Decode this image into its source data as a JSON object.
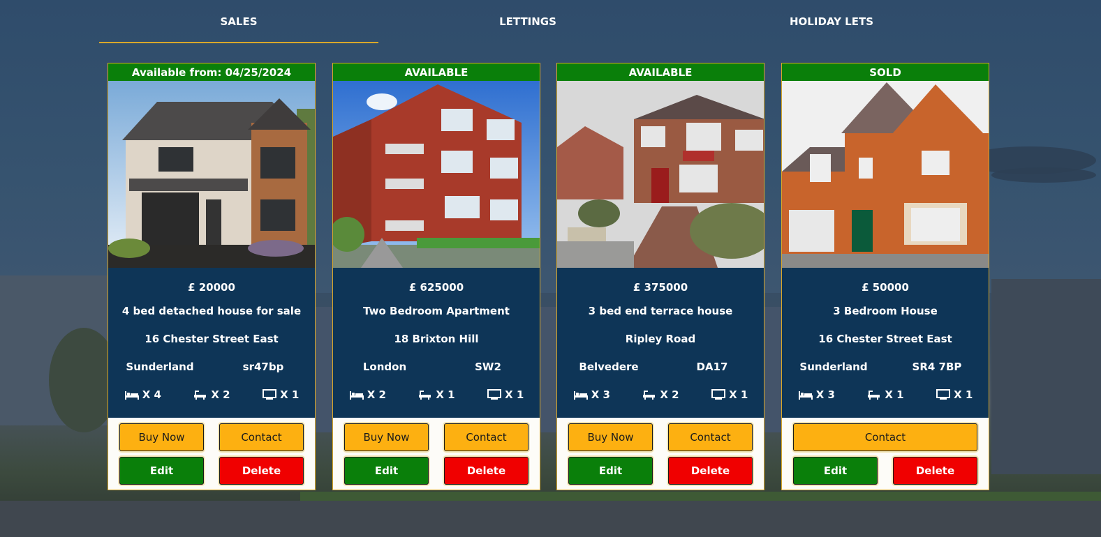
{
  "tabs": [
    {
      "label": "SALES",
      "active": true
    },
    {
      "label": "LETTINGS",
      "active": false
    },
    {
      "label": "HOLIDAY LETS",
      "active": false
    }
  ],
  "colors": {
    "accent": "#d9a82a",
    "status_green": "#0a7f0a",
    "info_panel": "#0e3557",
    "button_gold": "#fdb011",
    "button_green": "#0a7f0a",
    "button_red": "#f00000"
  },
  "listings": [
    {
      "status": "Available from: 04/25/2024",
      "photo": "detached-house-photo",
      "price": "£ 20000",
      "title": "4 bed detached house for sale",
      "street": "16 Chester Street East",
      "city": "Sunderland",
      "postcode": "sr47bp",
      "bedrooms": "X 4",
      "bathrooms": "X 2",
      "receptions": "X 1",
      "buy_label": "Buy Now",
      "contact_label": "Contact",
      "edit_label": "Edit",
      "delete_label": "Delete"
    },
    {
      "status": "AVAILABLE",
      "photo": "apartment-block-photo",
      "price": "£ 625000",
      "title": "Two Bedroom Apartment",
      "street": "18 Brixton Hill",
      "city": "London",
      "postcode": "SW2",
      "bedrooms": "X 2",
      "bathrooms": "X 1",
      "receptions": "X 1",
      "buy_label": "Buy Now",
      "contact_label": "Contact",
      "edit_label": "Edit",
      "delete_label": "Delete"
    },
    {
      "status": "AVAILABLE",
      "photo": "end-terrace-house-photo",
      "price": "£ 375000",
      "title": "3 bed end terrace house",
      "street": "Ripley Road",
      "city": "Belvedere",
      "postcode": "DA17",
      "bedrooms": "X 3",
      "bathrooms": "X 2",
      "receptions": "X 1",
      "buy_label": "Buy Now",
      "contact_label": "Contact",
      "edit_label": "Edit",
      "delete_label": "Delete"
    },
    {
      "status": "SOLD",
      "photo": "brick-house-photo",
      "price": "£ 50000",
      "title": "3 Bedroom House",
      "street": "16 Chester Street East",
      "city": "Sunderland",
      "postcode": "SR4 7BP",
      "bedrooms": "X 3",
      "bathrooms": "X 1",
      "receptions": "X 1",
      "contact_label": "Contact",
      "edit_label": "Edit",
      "delete_label": "Delete"
    }
  ]
}
